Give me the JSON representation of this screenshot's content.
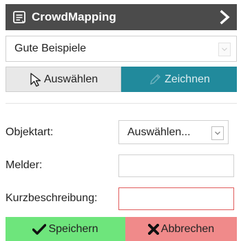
{
  "header": {
    "title": "CrowdMapping",
    "app_icon": "form-icon",
    "collapse_icon": "chevron-right-icon",
    "background": "#4b4b4b"
  },
  "preset": {
    "value": "Gute Beispiele",
    "caret_icon": "chevron-down-icon"
  },
  "mode": {
    "select_label": "Auswählen",
    "select_icon": "cursor-arrow-icon",
    "draw_label": "Zeichnen",
    "draw_icon": "pencil-icon",
    "active": "Zeichnen",
    "active_color": "#218a9c"
  },
  "form": {
    "object_type_label": "Objektart:",
    "object_type_value": "Auswählen...",
    "reporter_label": "Melder:",
    "reporter_value": "",
    "description_label": "Kurzbeschreibung:",
    "description_value": "",
    "invalid_color": "#e05a5a"
  },
  "footer": {
    "save_label": "Speichern",
    "save_icon": "checkmark-icon",
    "save_color": "#6ee57c",
    "cancel_label": "Abbrechen",
    "cancel_icon": "x-icon",
    "cancel_color": "#f08a8a"
  }
}
